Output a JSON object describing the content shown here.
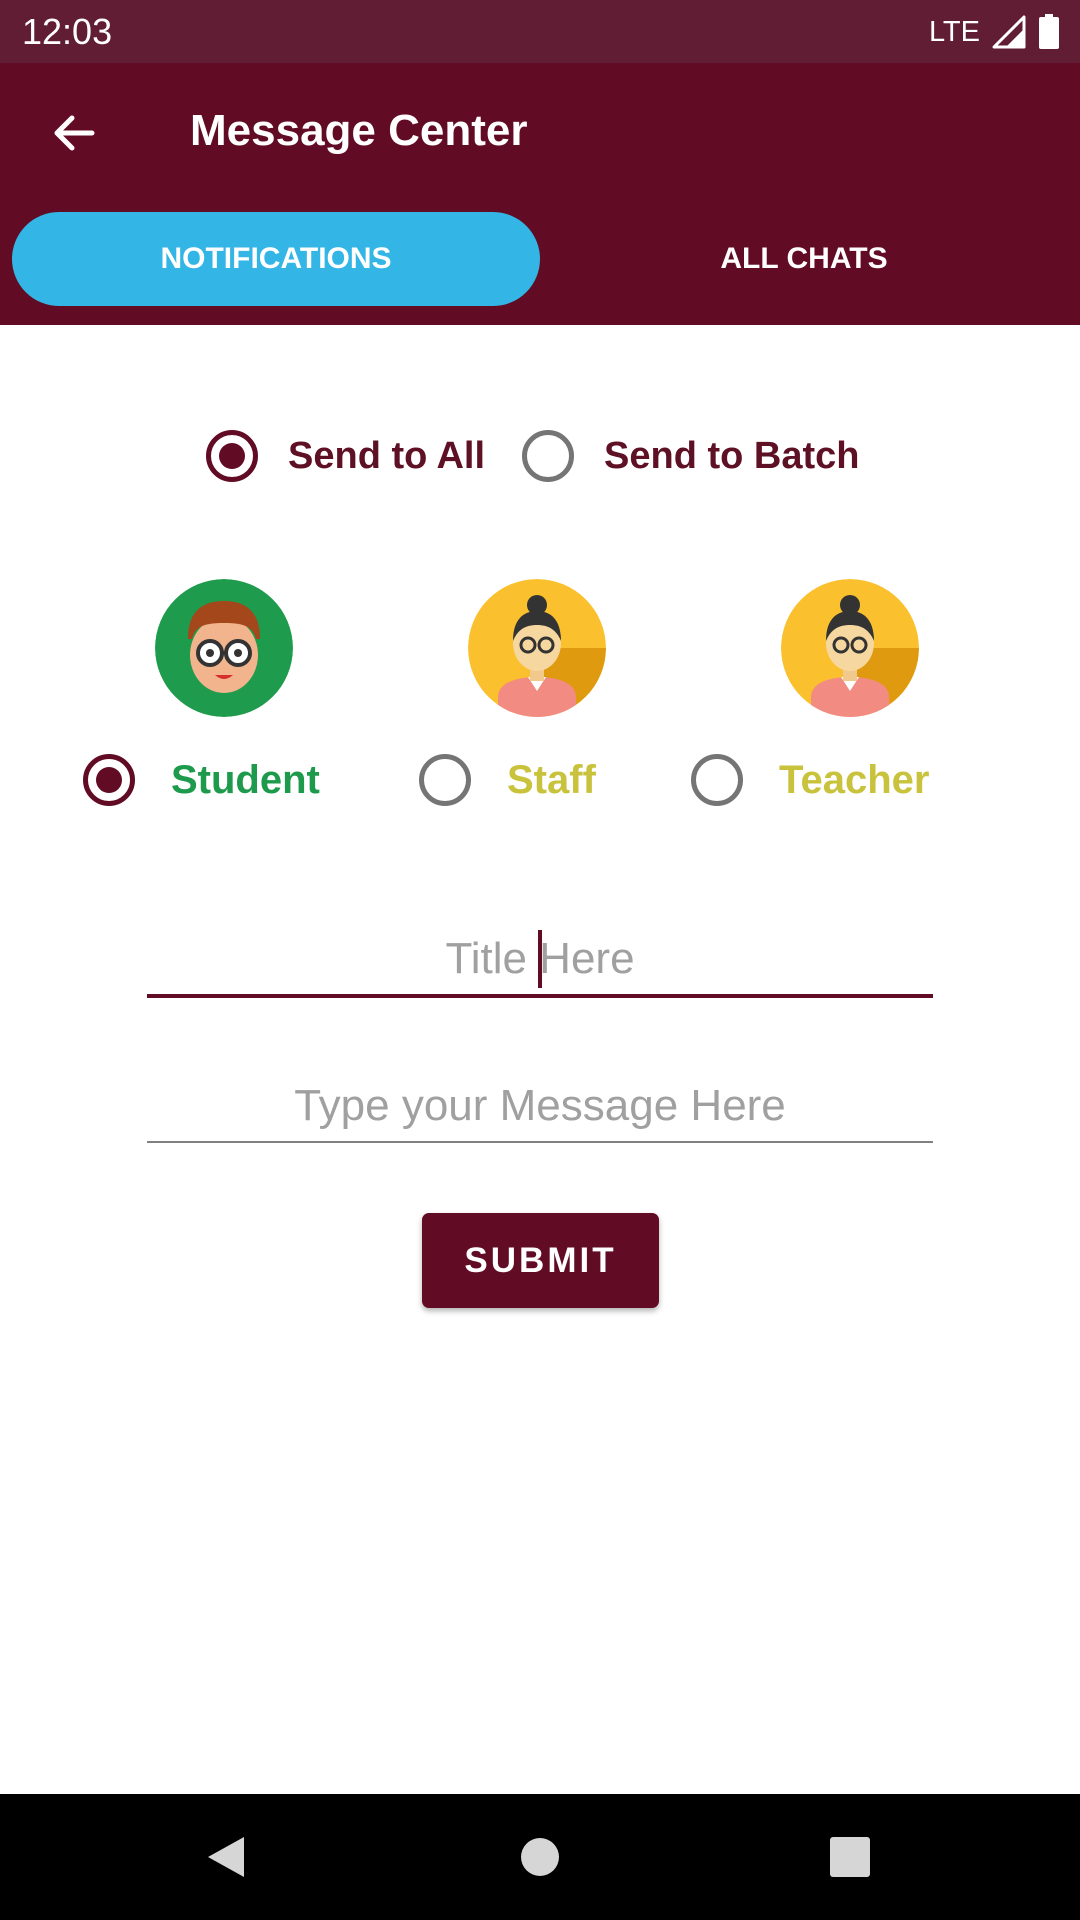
{
  "status_bar": {
    "time": "12:03",
    "network": "LTE",
    "icons": [
      "signal-icon",
      "battery-icon"
    ]
  },
  "header": {
    "title": "Message Center",
    "back_icon": "arrow-left-icon",
    "background": "#610c24"
  },
  "tabs": [
    {
      "label": "NOTIFICATIONS",
      "active": true,
      "color": "#33b5e6"
    },
    {
      "label": "ALL CHATS",
      "active": false
    }
  ],
  "send_options": {
    "selected": "all",
    "items": [
      {
        "id": "all",
        "label": "Send to All",
        "checked": true
      },
      {
        "id": "batch",
        "label": "Send to Batch",
        "checked": false
      }
    ]
  },
  "roles": {
    "selected": "student",
    "items": [
      {
        "id": "student",
        "label": "Student",
        "checked": true,
        "avatar": "student-avatar-icon",
        "color": "#1d9a4b"
      },
      {
        "id": "staff",
        "label": "Staff",
        "checked": false,
        "avatar": "staff-avatar-icon",
        "color": "#c8c23c"
      },
      {
        "id": "teacher",
        "label": "Teacher",
        "checked": false,
        "avatar": "teacher-avatar-icon",
        "color": "#c8c23c"
      }
    ]
  },
  "form": {
    "title_placeholder": "Title Here",
    "title_value": "",
    "message_placeholder": "Type your Message Here",
    "message_value": "",
    "submit_label": "SUBMIT"
  },
  "nav_bar": {
    "icons": [
      "back-triangle-icon",
      "home-circle-icon",
      "recents-square-icon"
    ]
  }
}
